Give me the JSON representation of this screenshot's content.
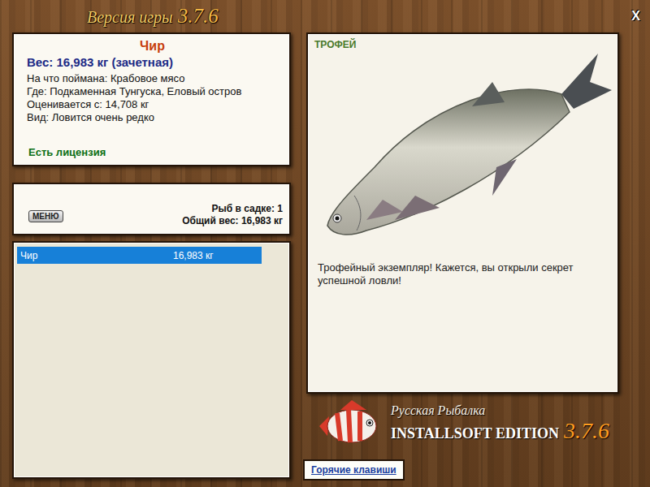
{
  "window": {
    "title": "Версия игры",
    "version": "3.7.6",
    "close": "X"
  },
  "fish": {
    "name": "Чир",
    "weight": "Вес: 16,983 кг (зачетная)",
    "details": [
      "На что поймана: Крабовое мясо",
      "Где: Подкаменная Тунгуска, Еловый остров",
      "Оценивается с: 14,708 кг",
      "Вид: Ловится очень редко"
    ],
    "license": "Есть лицензия"
  },
  "keeper": {
    "menu_button": "МЕНЮ",
    "count": "Рыб в садке: 1",
    "total": "Общий вес: 16,983 кг"
  },
  "catch_list": [
    {
      "name": "Чир",
      "weight": "16,983 кг",
      "selected": true
    }
  ],
  "trophy": {
    "badge": "ТРОФЕЙ",
    "message": "Трофейный экземпляр! Кажется, вы открыли секрет успешной ловли!"
  },
  "logo": {
    "line1": "Русская Рыбалка",
    "line2": "INSTALLSOFT EDITION",
    "version": "3.7.6"
  },
  "hotkeys_button": "Горячие клавиши"
}
